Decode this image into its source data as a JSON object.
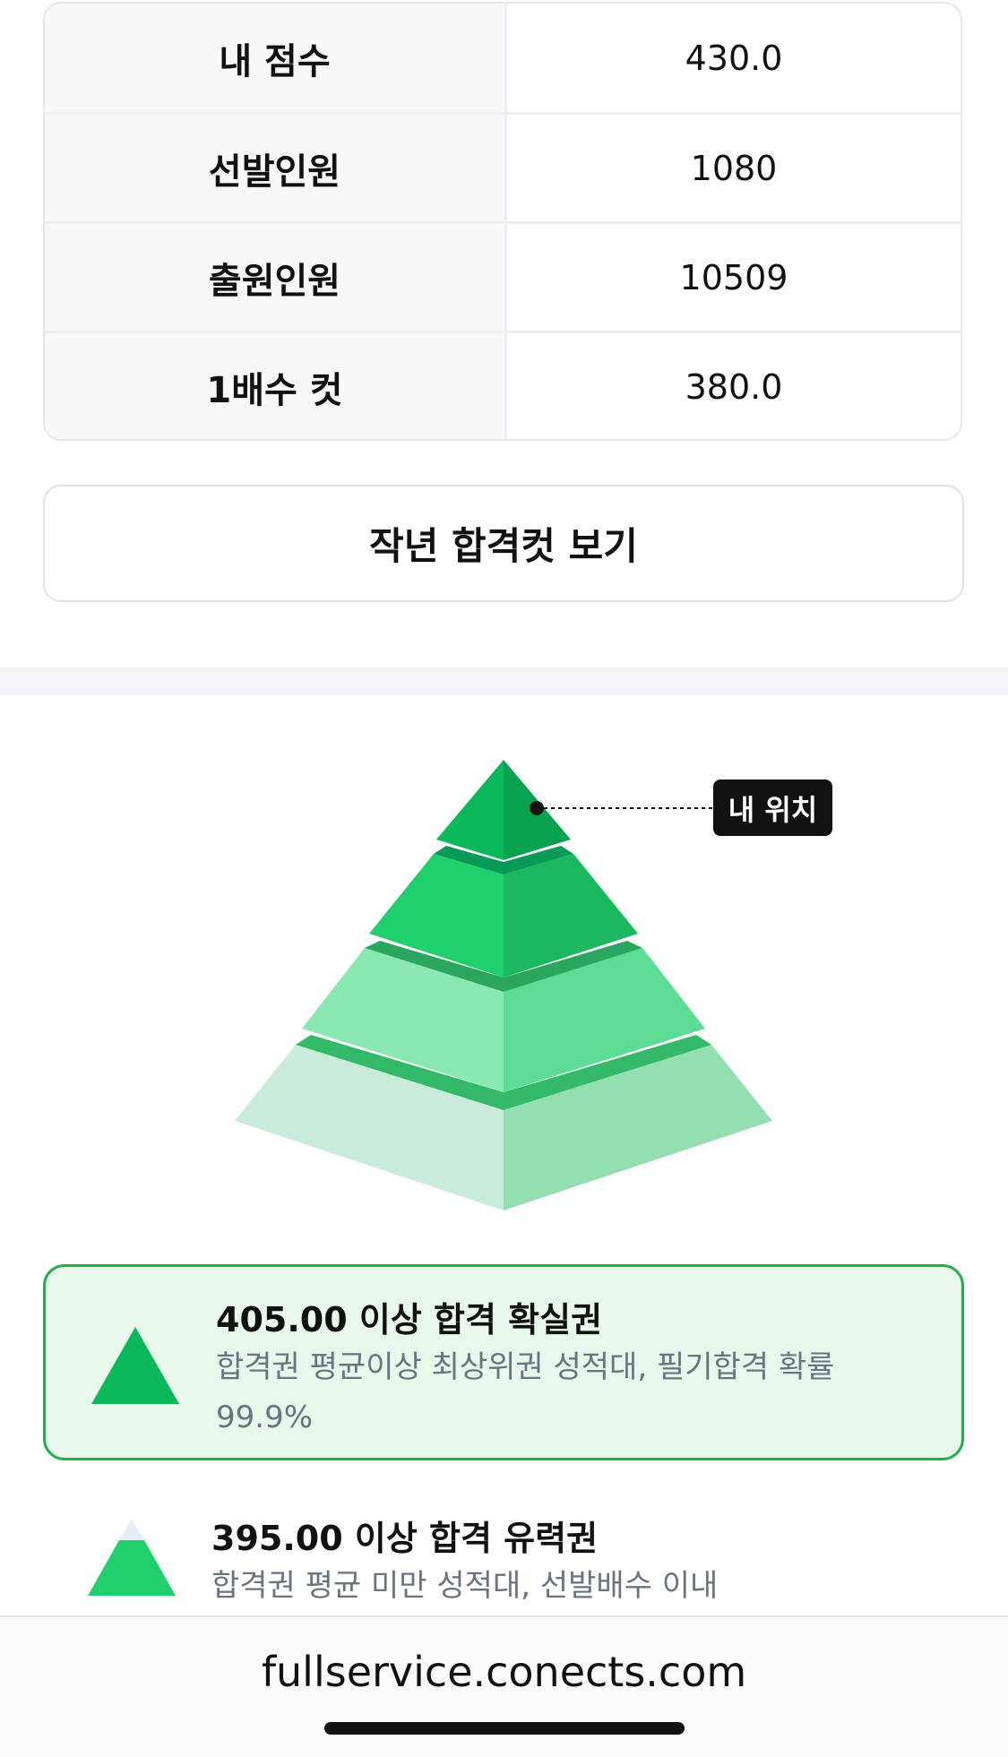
{
  "stats": {
    "rows": [
      {
        "label": "내 점수",
        "value": "430.0"
      },
      {
        "label": "선발인원",
        "value": "1080"
      },
      {
        "label": "출원인원",
        "value": "10509"
      },
      {
        "label": "1배수 컷",
        "value": "380.0"
      }
    ]
  },
  "last_year_button": "작년 합격컷 보기",
  "pyramid": {
    "my_position_tag": "내 위치",
    "colors": {
      "top": "#0bb85a",
      "second": "#22cf6d",
      "third": "#6fe09b",
      "bottom": "#c8ecd9"
    }
  },
  "tiers": [
    {
      "title": "405.00 이상 합격 확실권",
      "desc": "합격권 평균이상 최상위권 성적대, 필기합격 확률 99.9%",
      "color": "#0bb85a",
      "active": true
    },
    {
      "title": "395.00 이상 합격 유력권",
      "desc": "합격권 평균 미만 성적대, 선발배수 이내",
      "color": "#22cf6d",
      "active": false
    }
  ],
  "browser": {
    "url": "fullservice.conects.com"
  }
}
